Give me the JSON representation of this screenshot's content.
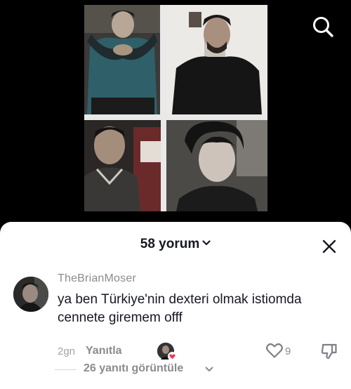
{
  "video": {
    "tiles": [
      "photo-boy-blue-shirt",
      "photo-man-black-shirt",
      "photo-man-sweater",
      "photo-boy-curly-hair"
    ]
  },
  "top_bar": {
    "search_icon": "search-icon"
  },
  "comments": {
    "count_label": "58 yorum",
    "close_icon": "close-icon",
    "items": [
      {
        "username": "TheBrianMoser",
        "text": "ya ben Türkiye'nin dexteri olmak istiomda cennete giremem offf",
        "time": "2gn",
        "reply_label": "Yanıtla",
        "likes": "9",
        "view_replies": "26 yanıtı görüntüle"
      }
    ]
  },
  "colors": {
    "sheet": "#ffffff",
    "text": "#161823",
    "muted": "#8a8b91",
    "creator_heart": "#fe2c55"
  }
}
